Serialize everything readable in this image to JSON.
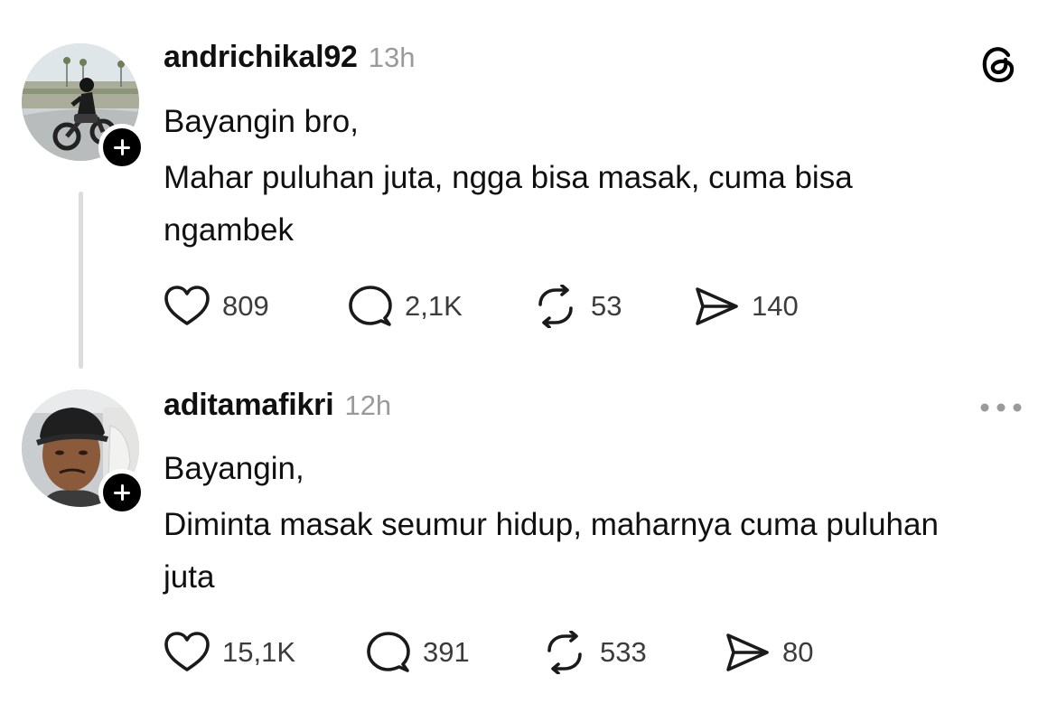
{
  "posts": [
    {
      "username": "andrichikal92",
      "time": "13h",
      "paragraphs": [
        "Bayangin bro,",
        "Mahar puluhan juta, ngga bisa masak, cuma bisa ngambek"
      ],
      "likes": "809",
      "replies": "2,1K",
      "reposts": "53",
      "shares": "140",
      "top_right_icon": "threads-logo-icon"
    },
    {
      "username": "aditamafikri",
      "time": "12h",
      "paragraphs": [
        "Bayangin,",
        "Diminta masak seumur hidup, maharnya cuma puluhan juta"
      ],
      "likes": "15,1K",
      "replies": "391",
      "reposts": "533",
      "shares": "80",
      "top_right_icon": "more-options-icon"
    }
  ],
  "colors": {
    "text": "#101010",
    "muted": "#9a9a9a",
    "count": "#3c3c3c",
    "thread_line": "#dcdcdc",
    "badge": "#000000"
  }
}
